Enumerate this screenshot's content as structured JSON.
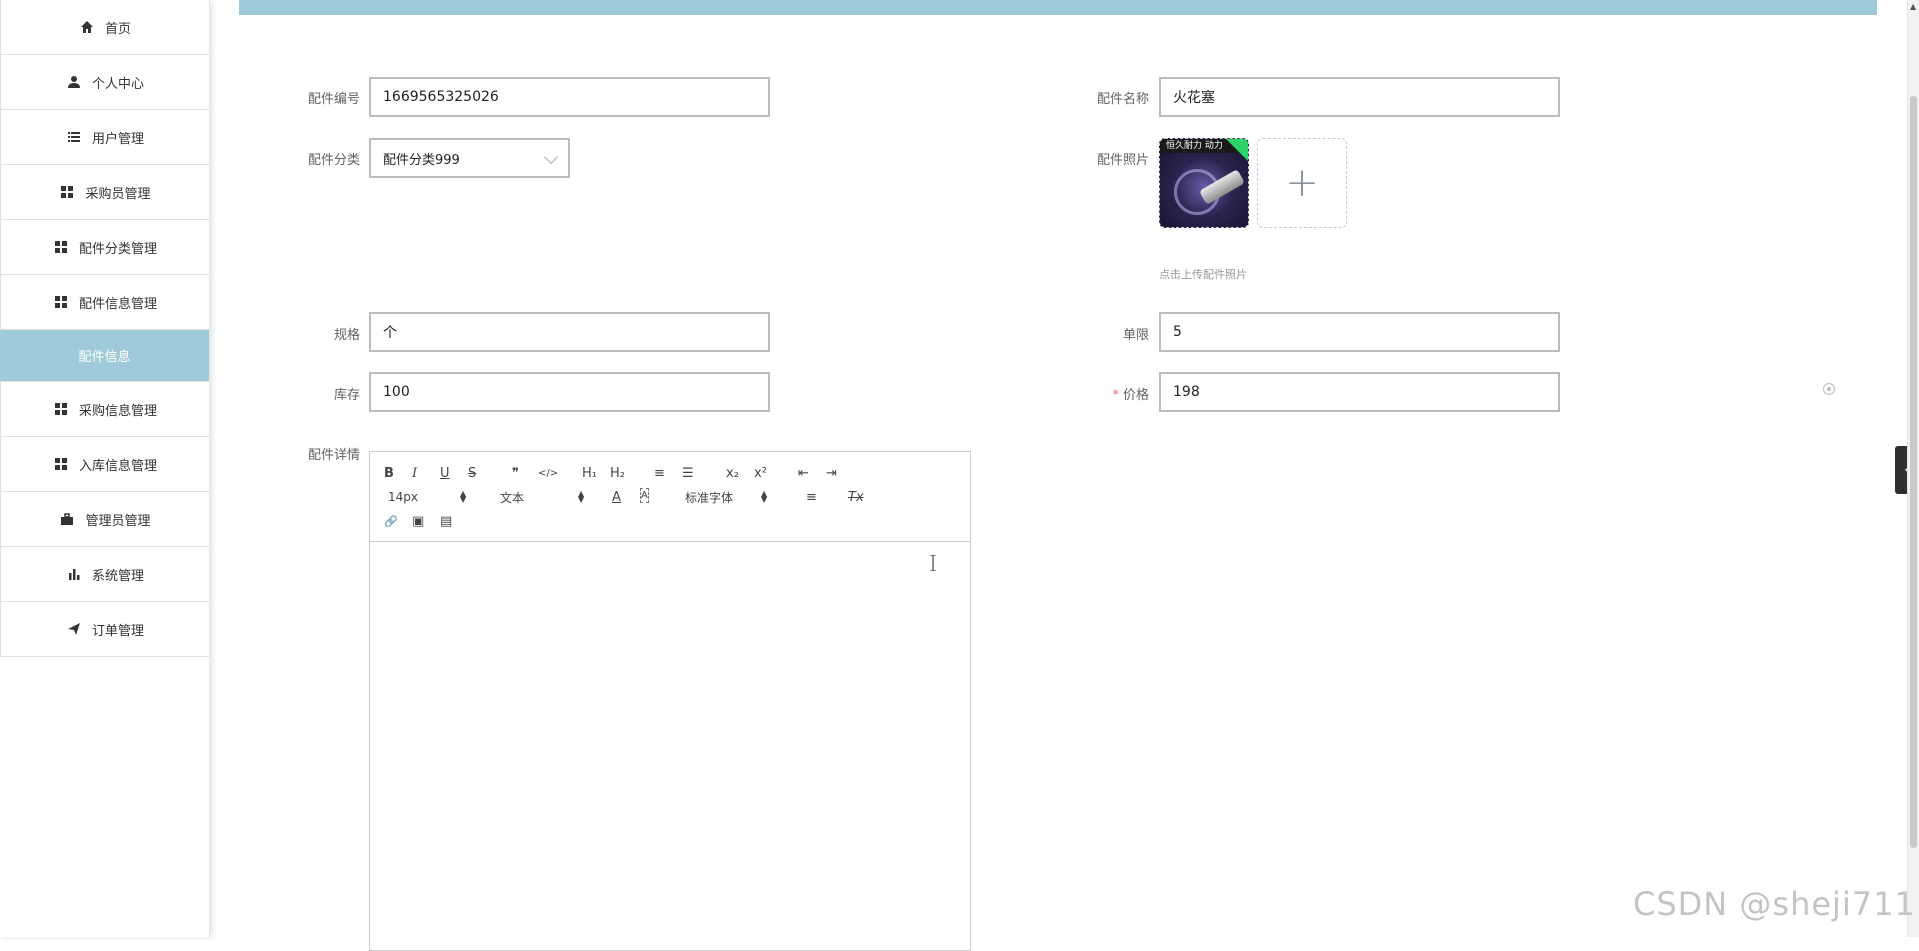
{
  "sidebar": {
    "items": [
      {
        "label": "首页",
        "icon": "home-icon"
      },
      {
        "label": "个人中心",
        "icon": "user-icon"
      },
      {
        "label": "用户管理",
        "icon": "list-icon"
      },
      {
        "label": "采购员管理",
        "icon": "grid-icon"
      },
      {
        "label": "配件分类管理",
        "icon": "grid-icon"
      },
      {
        "label": "配件信息管理",
        "icon": "grid-icon"
      },
      {
        "label": "配件信息",
        "icon": "",
        "active_sub": true
      },
      {
        "label": "采购信息管理",
        "icon": "grid-icon"
      },
      {
        "label": "入库信息管理",
        "icon": "grid-icon"
      },
      {
        "label": "管理员管理",
        "icon": "briefcase-icon"
      },
      {
        "label": "系统管理",
        "icon": "bar-chart-icon"
      },
      {
        "label": "订单管理",
        "icon": "send-icon"
      }
    ]
  },
  "form": {
    "part_no_label": "配件编号",
    "part_no_value": "1669565325026",
    "part_name_label": "配件名称",
    "part_name_value": "火花塞",
    "category_label": "配件分类",
    "category_value": "配件分类999",
    "photo_label": "配件照片",
    "photo_banner": "恒久耐力 动力",
    "photo_tip": "点击上传配件照片",
    "add_symbol": "+",
    "spec_label": "规格",
    "spec_value": "个",
    "limit_label": "单限",
    "limit_value": "5",
    "stock_label": "库存",
    "stock_value": "100",
    "price_required": "*",
    "price_label": "价格",
    "price_value": "198",
    "detail_label": "配件详情"
  },
  "editor": {
    "bold": "B",
    "italic": "I",
    "underline": "U",
    "strike": "S",
    "blockquote": "❞",
    "code": "</>",
    "h1": "H₁",
    "h2": "H₂",
    "ordered_list": "≡",
    "bullet_list": "☰",
    "sub": "x₂",
    "sup": "x²",
    "outdent": "⇤",
    "indent": "⇥",
    "size": "14px",
    "type": "文本",
    "font_color": "A",
    "bg_color": "A",
    "font": "标准字体",
    "align": "≡",
    "clear": "Tx",
    "link": "🔗",
    "image": "▣",
    "video": "▤"
  },
  "watermark": "CSDN @sheji711",
  "colors": {
    "accent": "#9fcad9",
    "required": "#f56c6c"
  }
}
